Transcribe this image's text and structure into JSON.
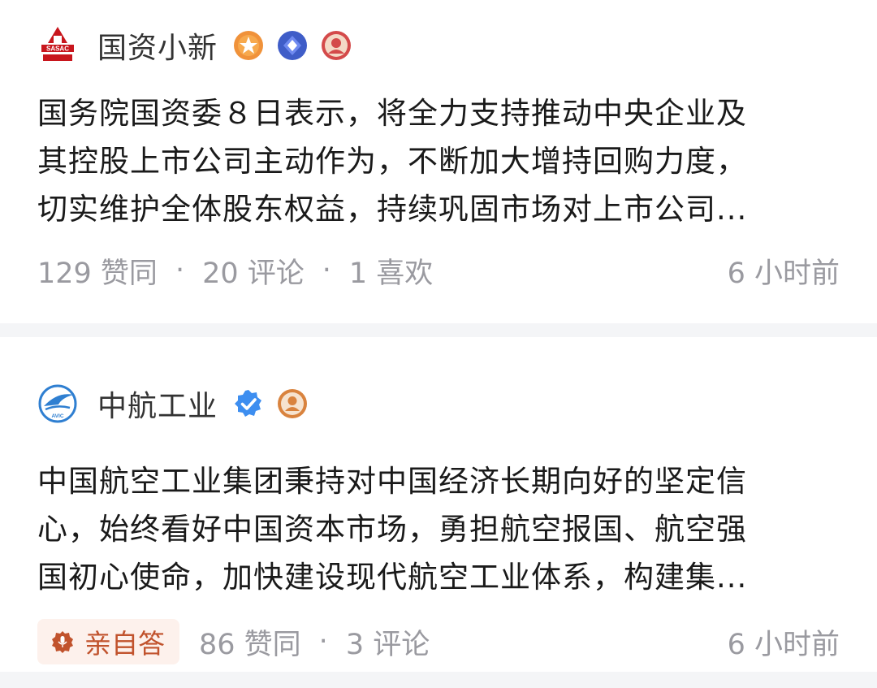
{
  "posts": [
    {
      "author": "国资小新",
      "logo_text": "SASAC",
      "content_lines": [
        "国务院国资委８日表示，将全力支持推动中央企业及",
        "其控股上市公司主动作为，不断加大增持回购力度，",
        "切实维护全体股东权益，持续巩固市场对上市公司..."
      ],
      "likes": "129 赞同",
      "comments": "20 评论",
      "favorites": "1 喜欢",
      "time": "6 小时前"
    },
    {
      "author": "中航工业",
      "logo_text": "AVIC",
      "content_lines": [
        "中国航空工业集团秉持对中国经济长期向好的坚定信",
        "心，始终看好中国资本市场，勇担航空报国、航空强",
        "国初心使命，加快建设现代航空工业体系，构建集..."
      ],
      "answer_tag": "亲自答",
      "likes": "86 赞同",
      "comments": "3 评论",
      "time": "6 小时前"
    }
  ],
  "separator": "·",
  "colors": {
    "text": "#1a1a1a",
    "meta": "#9a9aa0",
    "divider": "#f4f5f7",
    "verified_blue": "#3d8ef0",
    "sasac_red": "#c8161d",
    "tag_bg": "#fdf1ec",
    "tag_text": "#c1532d"
  }
}
